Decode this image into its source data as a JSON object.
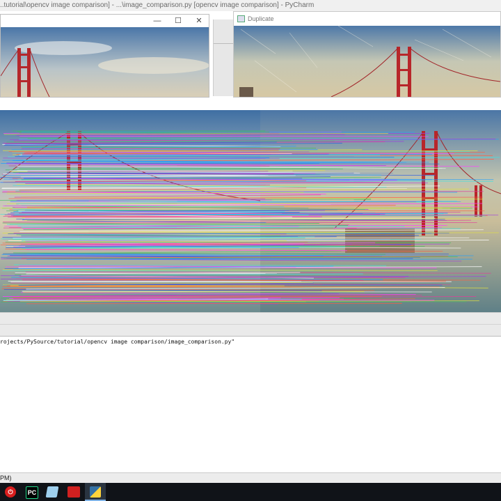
{
  "window": {
    "title": "..tutorial\\opencv image comparison] - ...\\image_comparison.py [opencv image comparison] - PyCharm"
  },
  "left_image_window": {
    "minimize_symbol": "—",
    "maximize_symbol": "☐",
    "close_symbol": "✕"
  },
  "duplicate_window": {
    "title": "Duplicate"
  },
  "console": {
    "output_line": "rojects/PySource/tutorial/opencv image comparison/image_comparison.py\""
  },
  "status_bar": {
    "text": "PM)"
  },
  "taskbar": {
    "icons": [
      {
        "name": "power",
        "color": "#d81e1e",
        "symbol": "⏻"
      },
      {
        "name": "pycharm",
        "color": "#21d789",
        "symbol": "PC"
      },
      {
        "name": "notes",
        "color": "#4aa3df",
        "symbol": ""
      },
      {
        "name": "video",
        "color": "#d02020",
        "symbol": ""
      },
      {
        "name": "python",
        "color": "#3572a5",
        "symbol": ""
      }
    ]
  },
  "colors": {
    "sky": "#6f93b8",
    "bridge_red": "#c0282c",
    "water": "#5c7f86"
  }
}
